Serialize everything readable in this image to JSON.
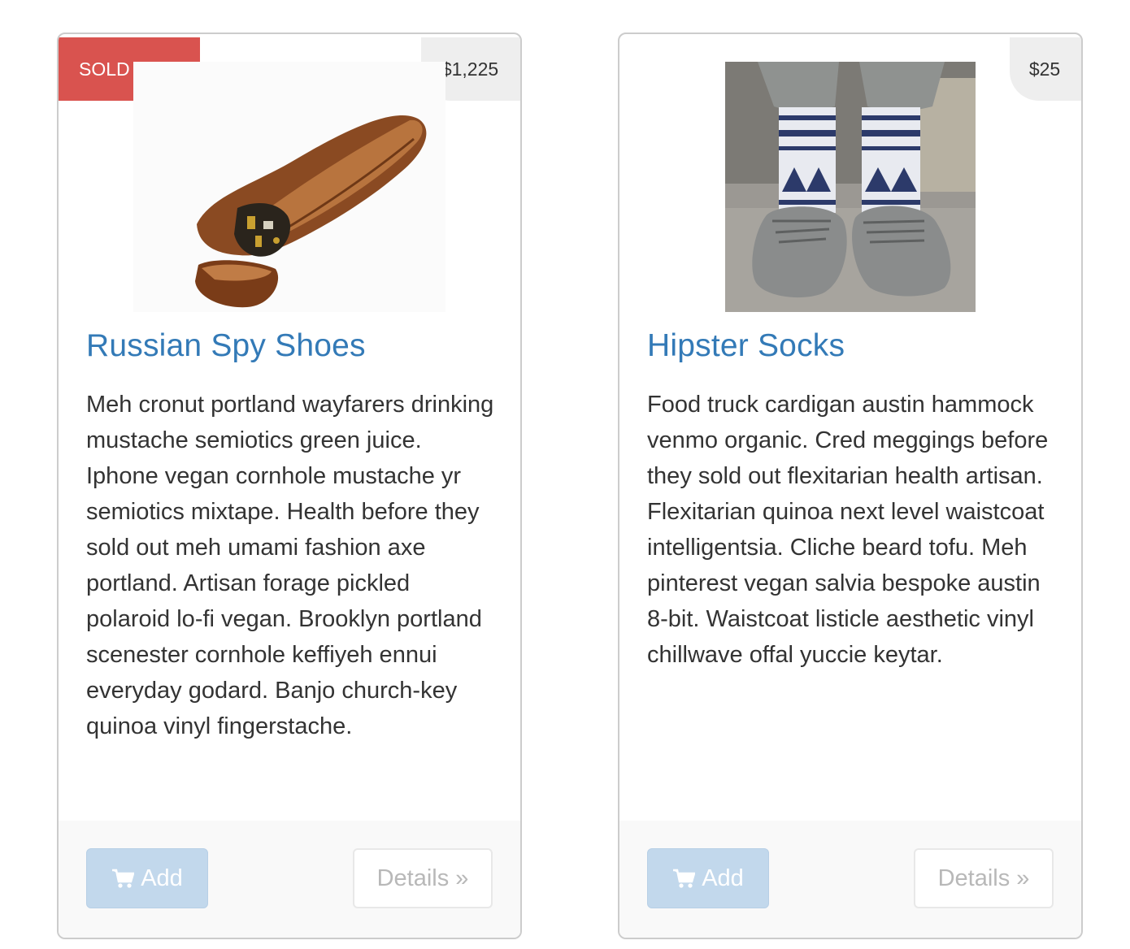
{
  "products": [
    {
      "sold_out_label": "SOLD OUT!",
      "price": "$1,225",
      "image_alt": "shoe-image",
      "title": "Russian Spy Shoes",
      "description": "Meh cronut portland wayfarers drinking mustache semiotics green juice. Iphone vegan cornhole mustache yr semiotics mixtape. Health before they sold out meh umami fashion axe portland. Artisan forage pickled polaroid lo-fi vegan. Brooklyn portland scenester cornhole keffiyeh ennui everyday godard. Banjo church-key quinoa vinyl fingerstache.",
      "add_label": "Add",
      "details_label": "Details »"
    },
    {
      "price": "$25",
      "image_alt": "socks-image",
      "title": "Hipster Socks",
      "description": "Food truck cardigan austin hammock venmo organic. Cred meggings before they sold out flexitarian health artisan. Flexitarian quinoa next level waistcoat intelligentsia. Cliche beard tofu. Meh pinterest vegan salvia bespoke austin 8-bit. Waistcoat listicle aesthetic vinyl chillwave offal yuccie keytar.",
      "add_label": "Add",
      "details_label": "Details »"
    }
  ],
  "colors": {
    "link": "#337ab7",
    "sold_out": "#d9534f",
    "add_button": "#c2d8ec"
  },
  "icons": [
    "shopping-cart-icon"
  ]
}
